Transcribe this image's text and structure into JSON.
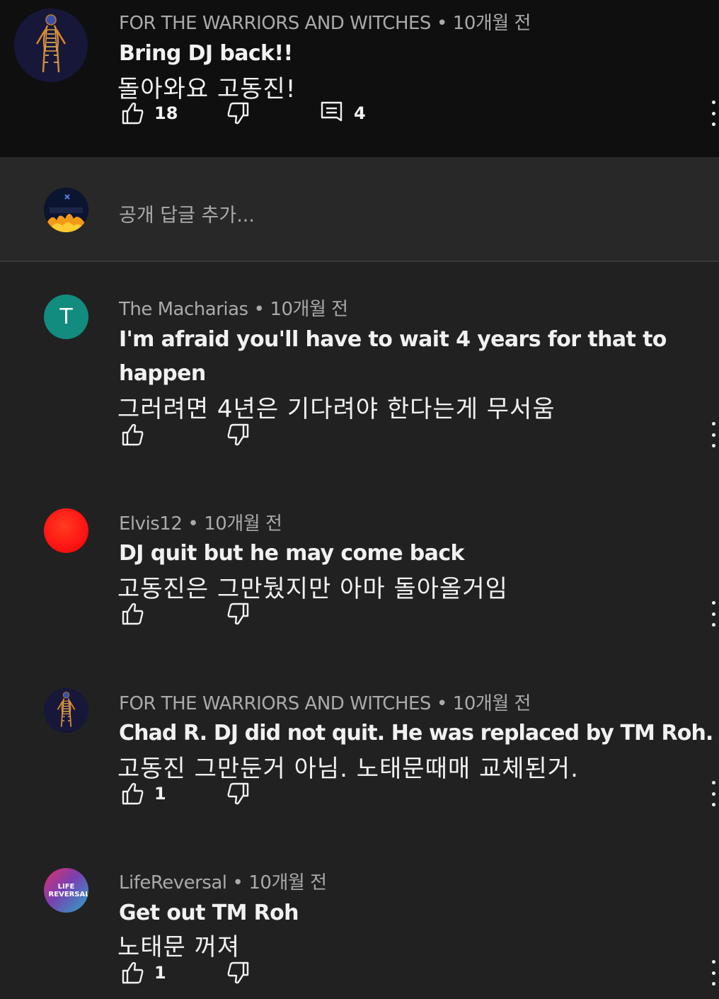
{
  "parent_comment": {
    "author": "FOR THE WARRIORS AND WITCHES",
    "time": "10개월 전",
    "text_en": "Bring DJ back!!",
    "text_ko": "돌아와요 고동진!",
    "likes": "18",
    "replies": "4"
  },
  "reply_box": {
    "placeholder": "공개 답글 추가..."
  },
  "replies": [
    {
      "author": "The Macharias",
      "time": "10개월 전",
      "avatar_letter": "T",
      "avatar_color": "#128c7e",
      "text_en": "I'm afraid you'll have to wait 4 years for that to happen",
      "text_ko": "그러려면 4년은 기다려야 한다는게 무서움",
      "likes": ""
    },
    {
      "author": "Elvis12",
      "time": "10개월 전",
      "avatar_color": "#ff1a1a",
      "text_en": "DJ quit but he may come back",
      "text_ko": "고동진은 그만뒀지만 아마 돌아올거임",
      "likes": ""
    },
    {
      "author": "FOR THE WARRIORS AND WITCHES",
      "time": "10개월 전",
      "text_en": "Chad R. DJ did not quit. He was replaced by TM Roh.",
      "text_ko": "고동진 그만둔거 아님. 노태문때매 교체된거.",
      "likes": "1"
    },
    {
      "author": "LifeReversal",
      "time": "10개월 전",
      "avatar_text": "LIFE REVERSAL",
      "text_en": "Get out TM Roh",
      "text_ko": "노태문 꺼져",
      "likes": "1"
    }
  ],
  "separator": "•"
}
